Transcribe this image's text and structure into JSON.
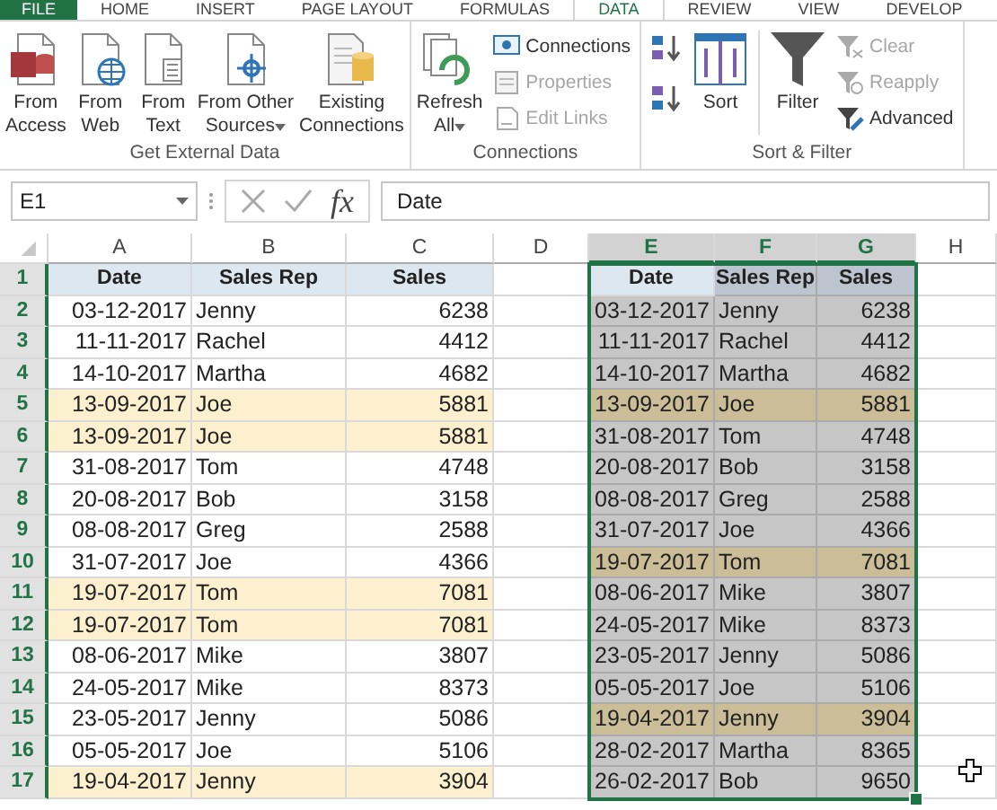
{
  "tabs": [
    {
      "label": "FILE",
      "kind": "file",
      "selected": false
    },
    {
      "label": "HOME",
      "kind": "tab",
      "selected": false
    },
    {
      "label": "INSERT",
      "kind": "tab",
      "selected": false
    },
    {
      "label": "PAGE LAYOUT",
      "kind": "tab",
      "selected": false
    },
    {
      "label": "FORMULAS",
      "kind": "tab",
      "selected": false
    },
    {
      "label": "DATA",
      "kind": "tab",
      "selected": true
    },
    {
      "label": "REVIEW",
      "kind": "tab",
      "selected": false
    },
    {
      "label": "VIEW",
      "kind": "tab",
      "selected": false
    },
    {
      "label": "DEVELOP",
      "kind": "tab",
      "selected": false
    }
  ],
  "ribbon": {
    "groups": [
      {
        "label": "Get External Data",
        "items": [
          {
            "kind": "large",
            "label": "From\nAccess"
          },
          {
            "kind": "large",
            "label": "From\nWeb"
          },
          {
            "kind": "large",
            "label": "From\nText"
          },
          {
            "kind": "large",
            "label": "From Other\nSources",
            "dropdown": true
          },
          {
            "kind": "large",
            "label": "Existing\nConnections"
          }
        ]
      },
      {
        "label": "Connections",
        "items": [
          {
            "kind": "large",
            "label": "Refresh\nAll",
            "dropdown": true
          },
          {
            "kind": "stack",
            "items": [
              {
                "label": "Connections",
                "disabled": false
              },
              {
                "label": "Properties",
                "disabled": true
              },
              {
                "label": "Edit Links",
                "disabled": true
              }
            ]
          }
        ]
      },
      {
        "label": "Sort & Filter",
        "items": [
          {
            "kind": "sort-icons"
          },
          {
            "kind": "large",
            "label": "Sort"
          },
          {
            "kind": "separator"
          },
          {
            "kind": "large",
            "label": "Filter"
          },
          {
            "kind": "stack",
            "items": [
              {
                "label": "Clear",
                "disabled": true
              },
              {
                "label": "Reapply",
                "disabled": true
              },
              {
                "label": "Advanced",
                "disabled": false
              }
            ]
          }
        ]
      }
    ]
  },
  "formula_bar": {
    "name_box": "E1",
    "function_label": "fx",
    "value": "Date"
  },
  "sheet": {
    "column_headers": [
      {
        "label": "A",
        "selected": false
      },
      {
        "label": "B",
        "selected": false
      },
      {
        "label": "C",
        "selected": false
      },
      {
        "label": "D",
        "selected": false
      },
      {
        "label": "E",
        "selected": true
      },
      {
        "label": "F",
        "selected": true
      },
      {
        "label": "G",
        "selected": true
      },
      {
        "label": "H",
        "selected": false
      }
    ],
    "row_headers": [
      {
        "label": "1",
        "selected": true
      },
      {
        "label": "2",
        "selected": true
      },
      {
        "label": "3",
        "selected": true
      },
      {
        "label": "4",
        "selected": true
      },
      {
        "label": "5",
        "selected": true
      },
      {
        "label": "6",
        "selected": true
      },
      {
        "label": "7",
        "selected": true
      },
      {
        "label": "8",
        "selected": true
      },
      {
        "label": "9",
        "selected": true
      },
      {
        "label": "10",
        "selected": true
      },
      {
        "label": "11",
        "selected": true
      },
      {
        "label": "12",
        "selected": true
      },
      {
        "label": "13",
        "selected": true
      },
      {
        "label": "14",
        "selected": true
      },
      {
        "label": "15",
        "selected": true
      },
      {
        "label": "16",
        "selected": true
      },
      {
        "label": "17",
        "selected": true
      }
    ],
    "left_table": {
      "columns": [
        "Date",
        "Sales Rep",
        "Sales"
      ],
      "rows": [
        {
          "cells": [
            "03-12-2017",
            "Jenny",
            "6238"
          ],
          "highlighted": false
        },
        {
          "cells": [
            "11-11-2017",
            "Rachel",
            "4412"
          ],
          "highlighted": false
        },
        {
          "cells": [
            "14-10-2017",
            "Martha",
            "4682"
          ],
          "highlighted": false
        },
        {
          "cells": [
            "13-09-2017",
            "Joe",
            "5881"
          ],
          "highlighted": true
        },
        {
          "cells": [
            "13-09-2017",
            "Joe",
            "5881"
          ],
          "highlighted": true
        },
        {
          "cells": [
            "31-08-2017",
            "Tom",
            "4748"
          ],
          "highlighted": false
        },
        {
          "cells": [
            "20-08-2017",
            "Bob",
            "3158"
          ],
          "highlighted": false
        },
        {
          "cells": [
            "08-08-2017",
            "Greg",
            "2588"
          ],
          "highlighted": false
        },
        {
          "cells": [
            "31-07-2017",
            "Joe",
            "4366"
          ],
          "highlighted": false
        },
        {
          "cells": [
            "19-07-2017",
            "Tom",
            "7081"
          ],
          "highlighted": true
        },
        {
          "cells": [
            "19-07-2017",
            "Tom",
            "7081"
          ],
          "highlighted": true
        },
        {
          "cells": [
            "08-06-2017",
            "Mike",
            "3807"
          ],
          "highlighted": false
        },
        {
          "cells": [
            "24-05-2017",
            "Mike",
            "8373"
          ],
          "highlighted": false
        },
        {
          "cells": [
            "23-05-2017",
            "Jenny",
            "5086"
          ],
          "highlighted": false
        },
        {
          "cells": [
            "05-05-2017",
            "Joe",
            "5106"
          ],
          "highlighted": false
        },
        {
          "cells": [
            "19-04-2017",
            "Jenny",
            "3904"
          ],
          "highlighted": true
        }
      ]
    },
    "right_table": {
      "selected": true,
      "columns": [
        "Date",
        "Sales Rep",
        "Sales"
      ],
      "rows": [
        {
          "cells": [
            "03-12-2017",
            "Jenny",
            "6238"
          ],
          "highlighted": false
        },
        {
          "cells": [
            "11-11-2017",
            "Rachel",
            "4412"
          ],
          "highlighted": false
        },
        {
          "cells": [
            "14-10-2017",
            "Martha",
            "4682"
          ],
          "highlighted": false
        },
        {
          "cells": [
            "13-09-2017",
            "Joe",
            "5881"
          ],
          "highlighted": true
        },
        {
          "cells": [
            "31-08-2017",
            "Tom",
            "4748"
          ],
          "highlighted": false
        },
        {
          "cells": [
            "20-08-2017",
            "Bob",
            "3158"
          ],
          "highlighted": false
        },
        {
          "cells": [
            "08-08-2017",
            "Greg",
            "2588"
          ],
          "highlighted": false
        },
        {
          "cells": [
            "31-07-2017",
            "Joe",
            "4366"
          ],
          "highlighted": false
        },
        {
          "cells": [
            "19-07-2017",
            "Tom",
            "7081"
          ],
          "highlighted": true
        },
        {
          "cells": [
            "08-06-2017",
            "Mike",
            "3807"
          ],
          "highlighted": false
        },
        {
          "cells": [
            "24-05-2017",
            "Mike",
            "8373"
          ],
          "highlighted": false
        },
        {
          "cells": [
            "23-05-2017",
            "Jenny",
            "5086"
          ],
          "highlighted": false
        },
        {
          "cells": [
            "05-05-2017",
            "Joe",
            "5106"
          ],
          "highlighted": false
        },
        {
          "cells": [
            "19-04-2017",
            "Jenny",
            "3904"
          ],
          "highlighted": true
        },
        {
          "cells": [
            "28-02-2017",
            "Martha",
            "8365"
          ],
          "highlighted": false
        },
        {
          "cells": [
            "26-02-2017",
            "Bob",
            "9650"
          ],
          "highlighted": false
        }
      ]
    }
  }
}
